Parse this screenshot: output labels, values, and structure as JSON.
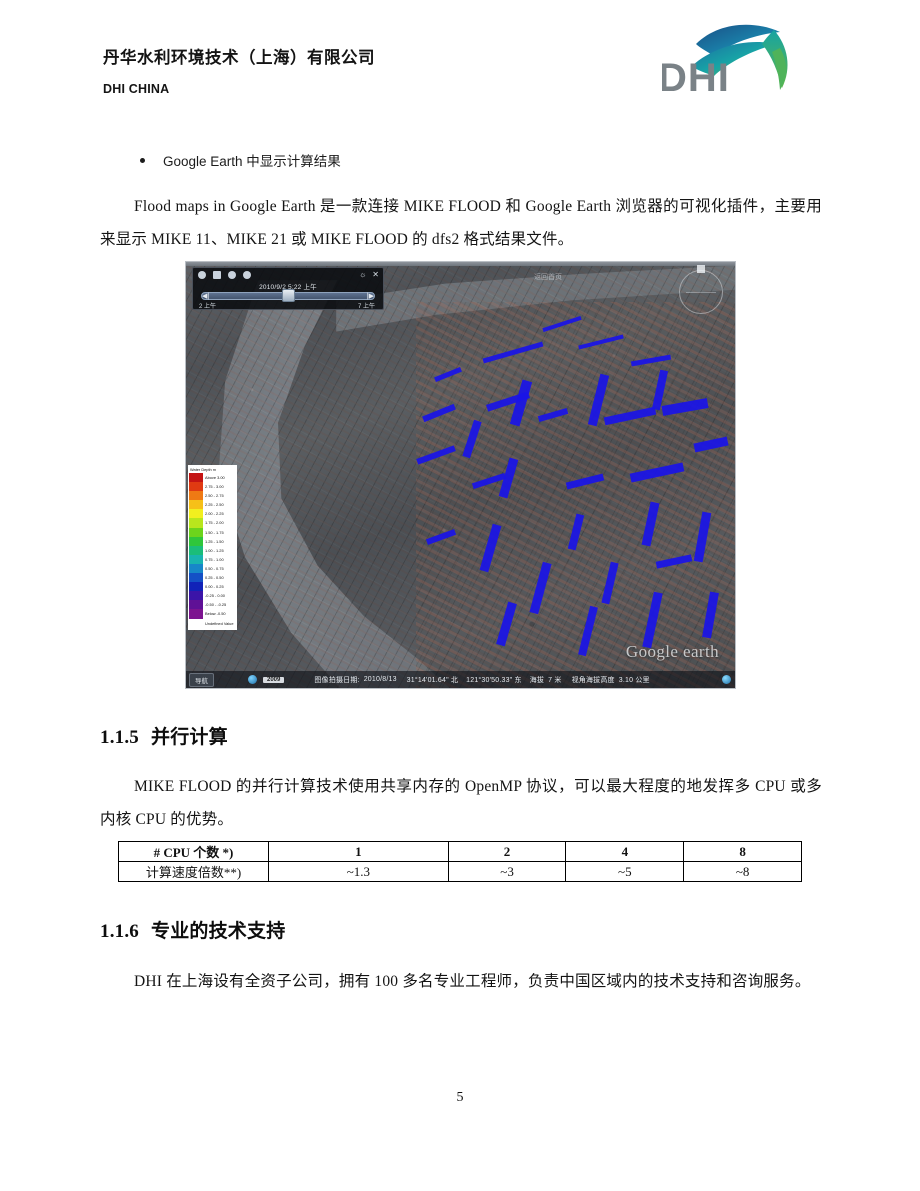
{
  "header": {
    "company_cn": "丹华水利环境技术（上海）有限公司",
    "company_en": "DHI CHINA",
    "logo_text": "DHI",
    "logo_colors": {
      "text": "#7a8287",
      "wave_blue": "#1c5f96",
      "wave_teal": "#1b9ba8",
      "wave_green": "#5fb949"
    }
  },
  "content": {
    "bullet": "Google Earth 中显示计算结果",
    "paragraph_intro": "Flood maps in Google Earth 是一款连接 MIKE FLOOD 和 Google Earth 浏览器的可视化插件，主要用来显示 MIKE 11、MIKE 21 或 MIKE FLOOD 的 dfs2 格式结果文件。",
    "section_parallel": {
      "number": "1.1.5",
      "title": "并行计算"
    },
    "paragraph_parallel": "MIKE FLOOD 的并行计算技术使用共享内存的 OpenMP 协议，可以最大程度的地发挥多 CPU 或多内核 CPU 的优势。",
    "section_support": {
      "number": "1.1.6",
      "title": "专业的技术支持"
    },
    "paragraph_support": "DHI 在上海设有全资子公司，拥有 100 多名专业工程师，负责中国区域内的技术支持和咨询服务。"
  },
  "cpu_table": {
    "rows": [
      {
        "label": "# CPU 个数 *)",
        "values": [
          "1",
          "2",
          "4",
          "8"
        ]
      },
      {
        "label": "计算速度倍数**)",
        "values": [
          "~1.3",
          "~3",
          "~5",
          "~8"
        ]
      }
    ]
  },
  "google_earth": {
    "top_label": "返回首页",
    "timebar": {
      "date": "2010/9/2   5:22 上午",
      "left_label": "2 上午",
      "right_label": "7 上午",
      "prev_icon": "skip-back-icon",
      "next_icon": "skip-forward-icon",
      "wrench_icon": "wrench-icon",
      "close_icon": "close-icon"
    },
    "legend": {
      "title": "Water Depth m",
      "bands": [
        {
          "label": "Above 3.00",
          "color": "#c41414"
        },
        {
          "label": "2.75 - 3.00",
          "color": "#e03a12"
        },
        {
          "label": "2.50 - 2.75",
          "color": "#ef7a14"
        },
        {
          "label": "2.25 - 2.50",
          "color": "#f6c018"
        },
        {
          "label": "2.00 - 2.25",
          "color": "#f2ef1f"
        },
        {
          "label": "1.75 - 2.00",
          "color": "#b8e61d"
        },
        {
          "label": "1.50 - 1.75",
          "color": "#6cd41c"
        },
        {
          "label": "1.25 - 1.50",
          "color": "#2fc63b"
        },
        {
          "label": "1.00 - 1.25",
          "color": "#1bbd7a"
        },
        {
          "label": "0.75 - 1.00",
          "color": "#19b4b0"
        },
        {
          "label": "0.50 - 0.75",
          "color": "#1787c9"
        },
        {
          "label": "0.25 - 0.50",
          "color": "#1450c6"
        },
        {
          "label": "0.00 - 0.25",
          "color": "#1122b8"
        },
        {
          "label": "-0.25 - 0.00",
          "color": "#3b14a8"
        },
        {
          "label": "-0.50 - -0.25",
          "color": "#5f1196"
        },
        {
          "label": "Below -0.50",
          "color": "#7d1390"
        },
        {
          "label": "Undefined Value",
          "color": "#ffffff"
        }
      ]
    },
    "status_bar": {
      "home_button": "导航",
      "year_badge": "2009",
      "imagery_date_label": "图像拍摄日期:",
      "imagery_date": "2010/8/13",
      "latitude": "31°14'01.64\" 北",
      "longitude": "121°30'50.33\" 东",
      "elevation_label": "海拔",
      "elevation": "7 米",
      "eye_alt_label": "视角海拔高度",
      "eye_alt": "3.10 公里"
    },
    "watermark": "Google earth"
  },
  "footer": {
    "page_number": "5"
  }
}
